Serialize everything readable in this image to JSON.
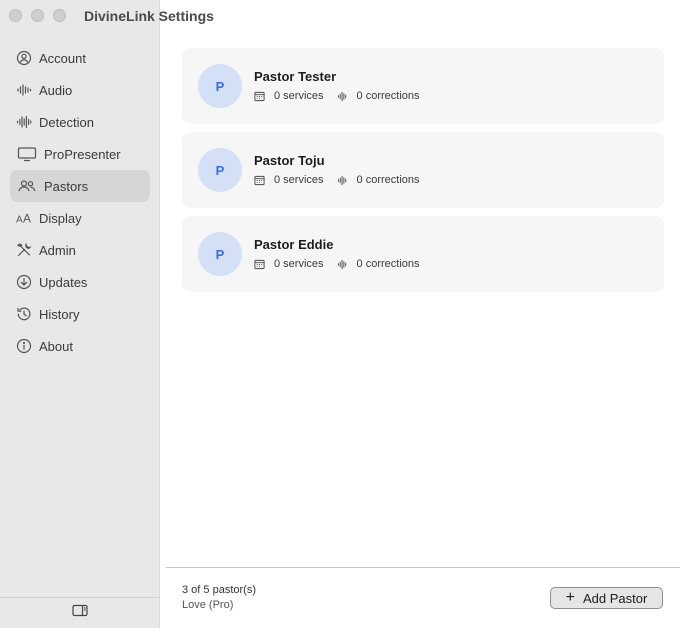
{
  "window": {
    "title": "DivineLink Settings"
  },
  "sidebar": {
    "items": [
      {
        "label": "Account",
        "icon": "person-circle-icon",
        "active": false
      },
      {
        "label": "Audio",
        "icon": "waveform-icon",
        "active": false
      },
      {
        "label": "Detection",
        "icon": "waveform-detect-icon",
        "active": false
      },
      {
        "label": "ProPresenter",
        "icon": "display-icon",
        "active": false
      },
      {
        "label": "Pastors",
        "icon": "people-icon",
        "active": true
      },
      {
        "label": "Display",
        "icon": "text-size-icon",
        "active": false
      },
      {
        "label": "Admin",
        "icon": "tools-icon",
        "active": false
      },
      {
        "label": "Updates",
        "icon": "download-circle-icon",
        "active": false
      },
      {
        "label": "History",
        "icon": "clock-history-icon",
        "active": false
      },
      {
        "label": "About",
        "icon": "info-circle-icon",
        "active": false
      }
    ],
    "toggle_icon": "sidebar-toggle-icon"
  },
  "pastors": [
    {
      "initial": "P",
      "name": "Pastor Tester",
      "services": "0 services",
      "corrections": "0 corrections"
    },
    {
      "initial": "P",
      "name": "Pastor Toju",
      "services": "0 services",
      "corrections": "0 corrections"
    },
    {
      "initial": "P",
      "name": "Pastor Eddie",
      "services": "0 services",
      "corrections": "0 corrections"
    }
  ],
  "footer": {
    "count": "3 of 5 pastor(s)",
    "plan": "Love (Pro)",
    "add_label": "Add Pastor"
  },
  "colors": {
    "avatar_bg": "#d3e0f6",
    "avatar_fg": "#3b6fd4",
    "active_bg": "#d6d6d6"
  }
}
